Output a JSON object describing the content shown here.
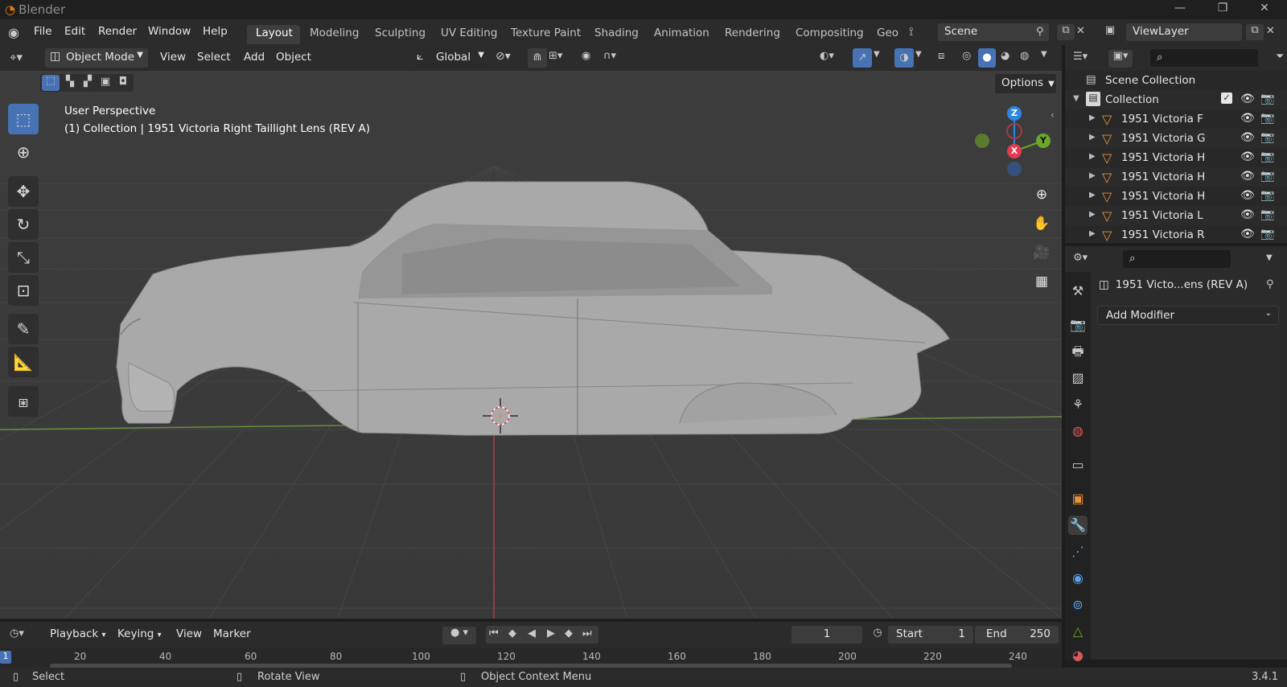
{
  "app": {
    "title": "Blender",
    "version": "3.4.1"
  },
  "menu": [
    "File",
    "Edit",
    "Render",
    "Window",
    "Help"
  ],
  "workspaces": [
    "Layout",
    "Modeling",
    "Sculpting",
    "UV Editing",
    "Texture Paint",
    "Shading",
    "Animation",
    "Rendering",
    "Compositing",
    "Geo"
  ],
  "scene": {
    "name": "Scene"
  },
  "view_layer": {
    "name": "ViewLayer"
  },
  "viewport": {
    "mode": "Object Mode",
    "menus": [
      "View",
      "Select",
      "Add",
      "Object"
    ],
    "transform_orientation": "Global",
    "options_label": "Options",
    "info_line1": "User Perspective",
    "info_line2": "(1) Collection | 1951 Victoria Right Taillight Lens (REV A)"
  },
  "gizmo": {
    "z": "Z",
    "y": "Y",
    "x": "X"
  },
  "outliner": {
    "scene_collection": "Scene Collection",
    "collection": "Collection",
    "items": [
      "1951 Victoria F",
      "1951 Victoria G",
      "1951 Victoria H",
      "1951 Victoria H",
      "1951 Victoria H",
      "1951 Victoria L",
      "1951 Victoria R"
    ]
  },
  "properties": {
    "object_name": "1951 Victo...ens (REV A)",
    "add_modifier": "Add Modifier"
  },
  "timeline": {
    "menus": [
      "Playback",
      "Keying",
      "View",
      "Marker"
    ],
    "current_frame": "1",
    "start_label": "Start",
    "start_value": "1",
    "end_label": "End",
    "end_value": "250",
    "ticks": [
      "20",
      "40",
      "60",
      "80",
      "100",
      "120",
      "140",
      "160",
      "180",
      "200",
      "220",
      "240"
    ],
    "frame_marker": "1"
  },
  "statusbar": {
    "select": "Select",
    "rotate": "Rotate View",
    "context": "Object Context Menu"
  },
  "colors": {
    "accent": "#4772b3",
    "object_orange": "#e8913a",
    "axis_x": "#e43b4e",
    "axis_y": "#6ca62b",
    "axis_z": "#2e87e0"
  }
}
